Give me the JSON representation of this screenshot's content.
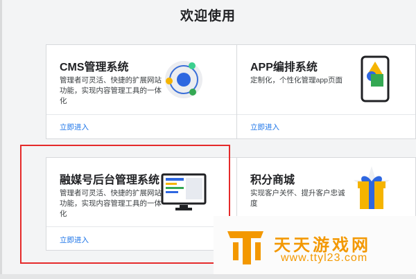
{
  "page": {
    "title": "欢迎使用"
  },
  "cards": [
    {
      "name": "CMS管理系统",
      "desc": "管理者可灵活、快捷的扩展网站功能，实现内容管理工具的一体化",
      "link": "立即进入"
    },
    {
      "name": "APP编排系统",
      "desc": "定制化，个性化管理app页面",
      "link": "立即进入"
    },
    {
      "name": "融媒号后台管理系统",
      "desc": "管理者可灵活、快捷的扩展网站功能，实现内容管理工具的一体化",
      "link": "立即进入"
    },
    {
      "name": "积分商城",
      "desc": "实现客户关怀、提升客户忠诚度"
    }
  ],
  "watermark": {
    "title": "天天游戏网",
    "url": "www.ttyl23.com"
  },
  "colors": {
    "accent": "#1a73e8",
    "highlight": "#e52a2a",
    "watermark": "#f39800"
  },
  "icons": {
    "card1": "orbit-network-icon",
    "card2": "phone-layout-icon",
    "card3": "monitor-dashboard-icon",
    "card4": "gift-box-icon"
  }
}
